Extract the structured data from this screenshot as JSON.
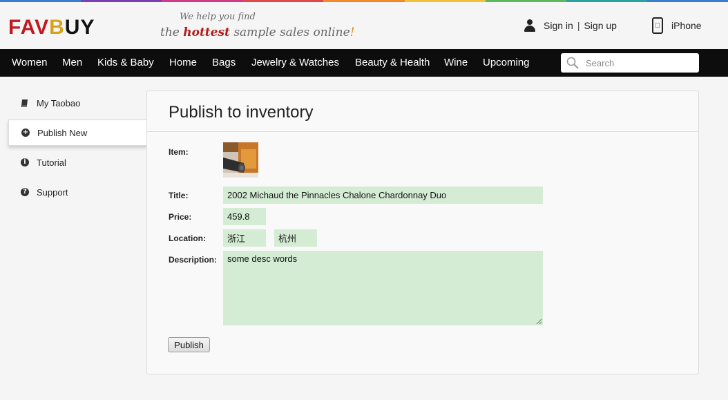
{
  "brand": {
    "logo_text_1": "FAV",
    "logo_text_2": "B",
    "logo_text_3": "UY",
    "tagline_line1": "We help you find",
    "tagline_the": "the",
    "tagline_hottest": "hottest",
    "tagline_rest": "sample sales online",
    "colors": {
      "red": "#c0191f",
      "gold": "#d7a219",
      "dark": "#111111"
    }
  },
  "top_links": {
    "sign_in": "Sign in",
    "separator": "|",
    "sign_up": "Sign up",
    "iphone": "iPhone"
  },
  "nav": {
    "items": [
      {
        "label": "Women"
      },
      {
        "label": "Men"
      },
      {
        "label": "Kids & Baby"
      },
      {
        "label": "Home"
      },
      {
        "label": "Bags"
      },
      {
        "label": "Jewelry & Watches"
      },
      {
        "label": "Beauty & Health"
      },
      {
        "label": "Wine"
      },
      {
        "label": "Upcoming"
      }
    ],
    "search_placeholder": "Search",
    "search_icon": "search-icon"
  },
  "sidebar": {
    "items": [
      {
        "label": "My Taobao",
        "icon": "book-icon",
        "active": false
      },
      {
        "label": "Publish New",
        "icon": "plus-circle-icon",
        "active": true
      },
      {
        "label": "Tutorial",
        "icon": "info-icon",
        "active": false
      },
      {
        "label": "Support",
        "icon": "question-icon",
        "active": false
      }
    ]
  },
  "form": {
    "title": "Publish to inventory",
    "item_label": "Item:",
    "title_label": "Title:",
    "title_value": "2002 Michaud the Pinnacles Chalone Chardonnay Duo",
    "price_label": "Price:",
    "price_value": "459.8",
    "location_label": "Location:",
    "province_value": "浙江",
    "city_value": "杭州",
    "description_label": "Description:",
    "description_value": "some desc words",
    "publish_button": "Publish",
    "field_color": "#d4ecd4"
  }
}
